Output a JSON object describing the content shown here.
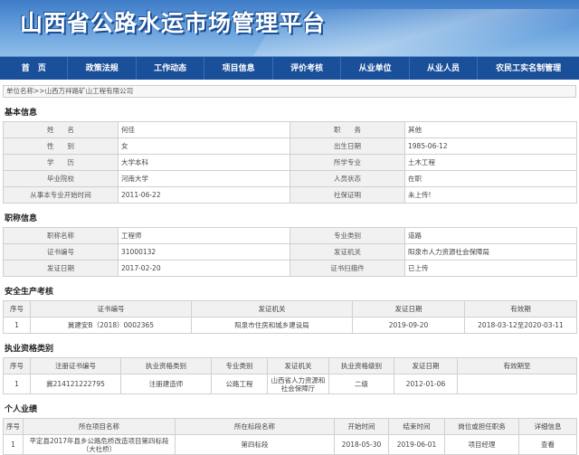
{
  "site_title": "山西省公路水运市场管理平台",
  "nav": [
    "首　页",
    "政策法规",
    "工作动态",
    "项目信息",
    "评价考核",
    "从业单位",
    "从业人员",
    "农民工实名制管理"
  ],
  "breadcrumb": "单位名称>>山西万祥路矿山工程有限公司",
  "basic": {
    "title": "基本信息",
    "rows": [
      {
        "k1": "姓　　名",
        "v1": "何佳",
        "k2": "职　　务",
        "v2": "其他"
      },
      {
        "k1": "性　　别",
        "v1": "女",
        "k2": "出生日期",
        "v2": "1985-06-12"
      },
      {
        "k1": "学　　历",
        "v1": "大学本科",
        "k2": "所学专业",
        "v2": "土木工程"
      },
      {
        "k1": "毕业院校",
        "v1": "河南大学",
        "k2": "人员状态",
        "v2": "在职"
      },
      {
        "k1": "从事本专业开始时间",
        "v1": "2011-06-22",
        "k2": "社保证明",
        "v2": "未上传!"
      }
    ]
  },
  "title_info": {
    "title": "职称信息",
    "rows": [
      {
        "k1": "职称名称",
        "v1": "工程师",
        "k2": "专业类别",
        "v2": "道路"
      },
      {
        "k1": "证书编号",
        "v1": "31000132",
        "k2": "发证机关",
        "v2": "阳泉市人力资源社会保障局"
      },
      {
        "k1": "发证日期",
        "v1": "2017-02-20",
        "k2": "证书扫描件",
        "v2": "已上传"
      }
    ]
  },
  "safety": {
    "title": "安全生产考核",
    "headers": [
      "序号",
      "证书编号",
      "发证机关",
      "发证日期",
      "有效期"
    ],
    "rows": [
      [
        "1",
        "冀建安B（2018）0002365",
        "阳泉市住房和城乡建设局",
        "2019-09-20",
        "2018-03-12至2020-03-11"
      ]
    ]
  },
  "qualification": {
    "title": "执业资格类别",
    "headers": [
      "序号",
      "注册证书编号",
      "执业资格类别",
      "专业类别",
      "发证机关",
      "执业资格级别",
      "发证日期",
      "有效期至"
    ],
    "rows": [
      [
        "1",
        "冀214121222795",
        "注册建造师",
        "公路工程",
        "山西省人力资源和社会保障厅",
        "二级",
        "2012-01-06",
        ""
      ]
    ]
  },
  "performance": {
    "title": "个人业绩",
    "headers": [
      "序号",
      "所在项目名称",
      "所在标段名称",
      "开始时间",
      "结束时间",
      "岗位或担任职务",
      "详细信息"
    ],
    "rows": [
      [
        "1",
        "平定县2017年县乡公路危桥改造项目第四标段（大社桥）",
        "第四标段",
        "2018-05-30",
        "2019-06-01",
        "项目经理",
        "查看"
      ]
    ]
  }
}
